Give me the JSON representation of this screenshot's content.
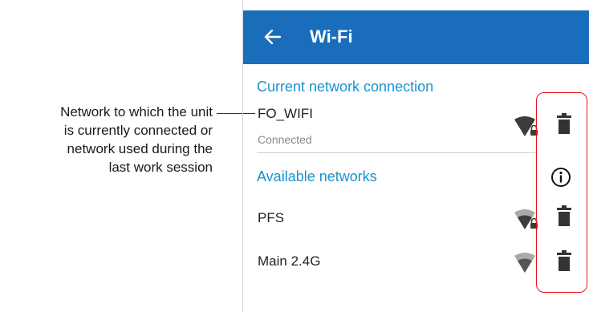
{
  "callout": {
    "lines": [
      "Network to which the unit",
      "is currently connected or",
      "network used during the",
      "last work session"
    ]
  },
  "header": {
    "back_icon": "arrow-left-icon",
    "title": "Wi-Fi",
    "background_color": "#1a6dbb"
  },
  "current": {
    "section_title": "Current network connection",
    "network": {
      "name": "FO_WIFI",
      "status": "Connected",
      "signal_icon": "wifi-locked-icon",
      "delete_icon": "trash-icon"
    }
  },
  "available": {
    "section_title": "Available networks",
    "info_icon": "info-icon",
    "networks": [
      {
        "name": "PFS",
        "signal_icon": "wifi-locked-icon",
        "delete_icon": "trash-icon"
      },
      {
        "name": "Main 2.4G",
        "signal_icon": "wifi-icon",
        "delete_icon": "trash-icon"
      }
    ]
  },
  "colors": {
    "accent": "#1a93cf",
    "highlight": "#e8101d"
  }
}
